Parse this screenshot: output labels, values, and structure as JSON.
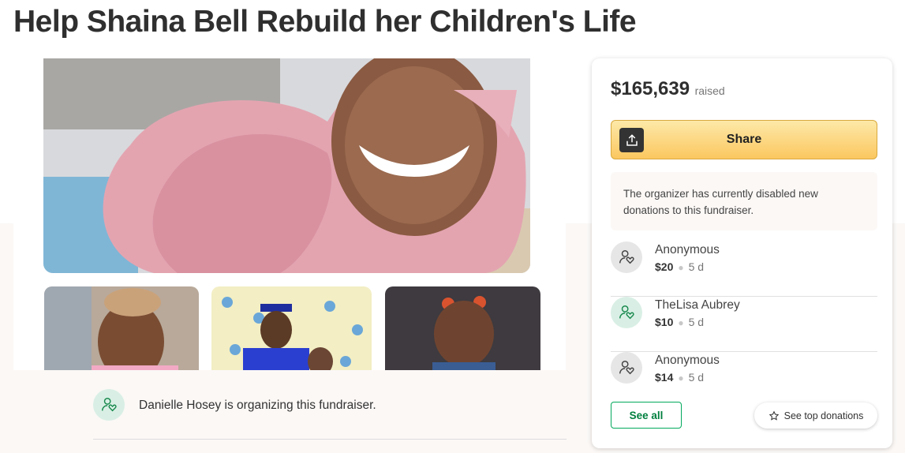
{
  "page": {
    "title": "Help Shaina Bell Rebuild her Children's Life"
  },
  "organizer": {
    "text": "Danielle Hosey is organizing this fundraiser.",
    "avatar_icon": "donor-heart-icon"
  },
  "sidebar": {
    "amount": "$165,639",
    "amount_label": "raised",
    "share_label": "Share",
    "share_icon": "share-upload-icon",
    "notice": "The organizer has currently disabled new donations to this fundraiser.",
    "donations": [
      {
        "name": "Anonymous",
        "amount": "$20",
        "time": "5 d",
        "avatar": "gray"
      },
      {
        "name": "TheLisa Aubrey",
        "amount": "$10",
        "time": "5 d",
        "avatar": "green"
      },
      {
        "name": "Anonymous",
        "amount": "$14",
        "time": "5 d",
        "avatar": "gray"
      }
    ],
    "see_all_label": "See all",
    "top_donations_label": "See top donations",
    "top_donations_icon": "star-outline-icon"
  },
  "colors": {
    "accent_green": "#02a95c",
    "share_yellow": "#fbc760",
    "band_bg": "#fbf8f6"
  }
}
